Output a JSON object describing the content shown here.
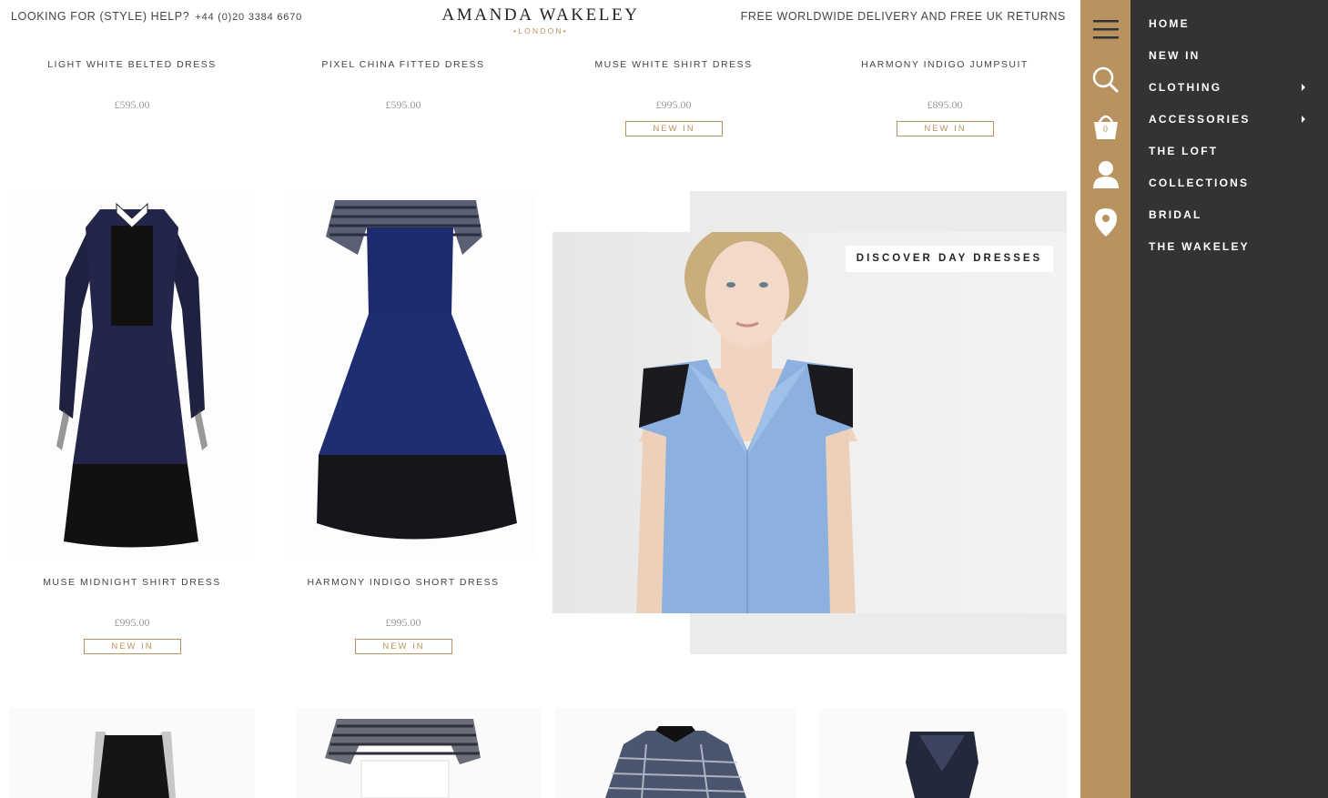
{
  "header": {
    "help_text": "LOOKING FOR (STYLE) HELP?",
    "phone": "+44 (0)20 3384 6670",
    "logo_name": "AMANDA WAKELEY",
    "logo_city": "•LONDON•",
    "delivery": "FREE WORLDWIDE DELIVERY AND FREE UK RETURNS"
  },
  "products_row1": [
    {
      "name": "LIGHT WHITE BELTED DRESS",
      "price": "£595.00",
      "badge": ""
    },
    {
      "name": "PIXEL CHINA FITTED DRESS",
      "price": "£595.00",
      "badge": ""
    },
    {
      "name": "MUSE WHITE SHIRT DRESS",
      "price": "£995.00",
      "badge": "NEW IN"
    },
    {
      "name": "HARMONY INDIGO JUMPSUIT",
      "price": "£895.00",
      "badge": "NEW IN"
    }
  ],
  "products_row2": [
    {
      "name": "MUSE MIDNIGHT SHIRT DRESS",
      "price": "£995.00",
      "badge": "NEW IN"
    },
    {
      "name": "HARMONY INDIGO SHORT DRESS",
      "price": "£995.00",
      "badge": "NEW IN"
    }
  ],
  "promo": {
    "label": "DISCOVER DAY DRESSES"
  },
  "cart": {
    "count": "0"
  },
  "menu": {
    "items": [
      "HOME",
      "NEW IN",
      "CLOTHING",
      "ACCESSORIES",
      "THE LOFT",
      "COLLECTIONS",
      "BRIDAL",
      "THE WAKELEY"
    ]
  },
  "colors": {
    "accent": "#b8925f",
    "menu_bg": "#333333"
  }
}
